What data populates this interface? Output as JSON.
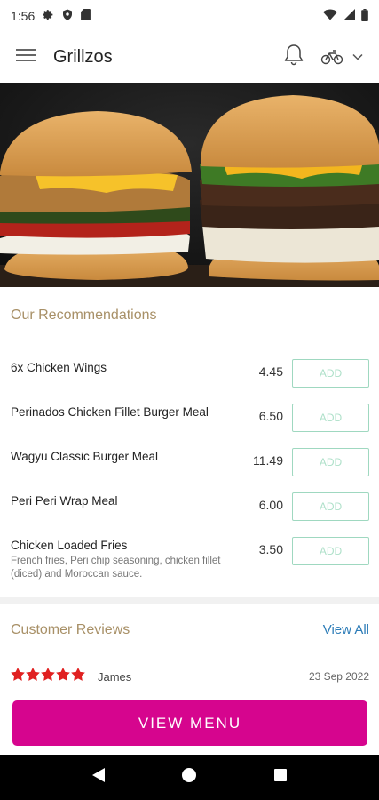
{
  "status_bar": {
    "time": "1:56"
  },
  "app_bar": {
    "title": "Grillzos"
  },
  "recommendations": {
    "title": "Our Recommendations",
    "add_label": "ADD",
    "items": [
      {
        "name": "6x Chicken Wings",
        "price": "4.45",
        "description": ""
      },
      {
        "name": "Perinados Chicken Fillet Burger Meal",
        "price": "6.50",
        "description": ""
      },
      {
        "name": "Wagyu Classic Burger Meal",
        "price": "11.49",
        "description": ""
      },
      {
        "name": "Peri Peri Wrap Meal",
        "price": "6.00",
        "description": ""
      },
      {
        "name": "Chicken Loaded Fries",
        "price": "3.50",
        "description": "French fries, Peri chip seasoning, chicken fillet (diced) and Moroccan sauce."
      }
    ]
  },
  "reviews": {
    "title": "Customer Reviews",
    "view_all": "View All",
    "items": [
      {
        "name": "James",
        "date": "23 Sep 2022",
        "rating": 5
      }
    ]
  },
  "cta": {
    "label": "VIEW MENU"
  },
  "colors": {
    "accent": "#d6058e",
    "heading": "#a89067",
    "link": "#2e7db8",
    "add_border": "#9fd8c0",
    "star": "#e02020"
  },
  "icons": [
    "gear-icon",
    "shield-icon",
    "sd-card-icon",
    "wifi-icon",
    "signal-icon",
    "battery-icon",
    "menu-icon",
    "bell-icon",
    "bicycle-icon",
    "chevron-down-icon",
    "star-icon",
    "back-icon",
    "home-icon",
    "recents-icon"
  ]
}
